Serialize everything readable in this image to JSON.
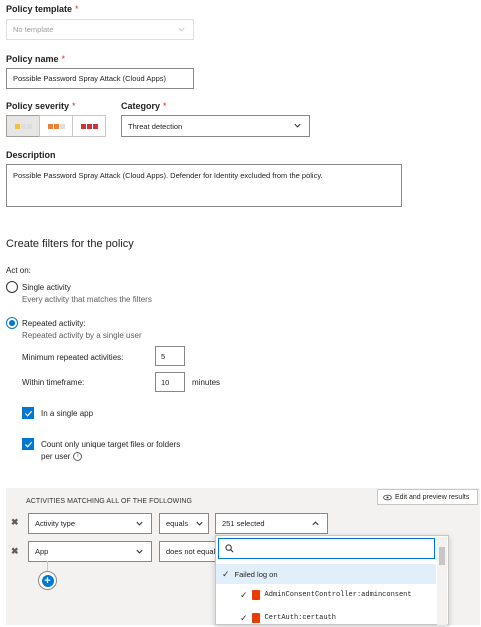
{
  "policy_template": {
    "label": "Policy template",
    "required_mark": "*",
    "placeholder": "No template"
  },
  "policy_name": {
    "label": "Policy name",
    "required_mark": "*",
    "value": "Possible Password Spray Attack (Cloud Apps)"
  },
  "policy_severity": {
    "label": "Policy severity",
    "required_mark": "*",
    "selected": "low"
  },
  "category": {
    "label": "Category",
    "required_mark": "*",
    "value": "Threat detection"
  },
  "description": {
    "label": "Description",
    "value": "Possible Password Spray Attack (Cloud Apps). Defender for Identity excluded from the policy."
  },
  "filters": {
    "heading": "Create filters for the policy",
    "act_on_label": "Act on:",
    "single": {
      "label": "Single activity",
      "sub": "Every activity that matches the filters",
      "selected": false
    },
    "repeated": {
      "label": "Repeated activity:",
      "sub": "Repeated activity by a single user",
      "selected": true
    },
    "min_repeated": {
      "label": "Minimum repeated activities:",
      "value": "5"
    },
    "timeframe": {
      "label": "Within timeframe:",
      "value": "10",
      "unit": "minutes"
    },
    "single_app": {
      "label": "In a single app",
      "checked": true
    },
    "unique_targets": {
      "label": "Count only unique target files or folders",
      "label2": "per user",
      "checked": true
    }
  },
  "activities": {
    "heading": "ACTIVITIES MATCHING ALL OF THE FOLLOWING",
    "edit_preview": "Edit and preview results",
    "row1": {
      "field": "Activity type",
      "operator": "equals",
      "value": "251 selected"
    },
    "row2": {
      "field": "App",
      "operator": "does not equal"
    },
    "add_label": "+"
  },
  "dropdown": {
    "search_placeholder": "",
    "items": [
      {
        "label": "Failed log on",
        "checked": true,
        "group": true
      },
      {
        "label": "AdminConsentController:adminconsent",
        "checked": true,
        "group": false
      },
      {
        "label": "CertAuth:certauth",
        "checked": true,
        "group": false
      }
    ]
  },
  "colors": {
    "accent": "#0078d4",
    "required": "#c8322f",
    "sev_low": "#f1c232",
    "sev_med": "#e8833a",
    "sev_high": "#d13438"
  }
}
